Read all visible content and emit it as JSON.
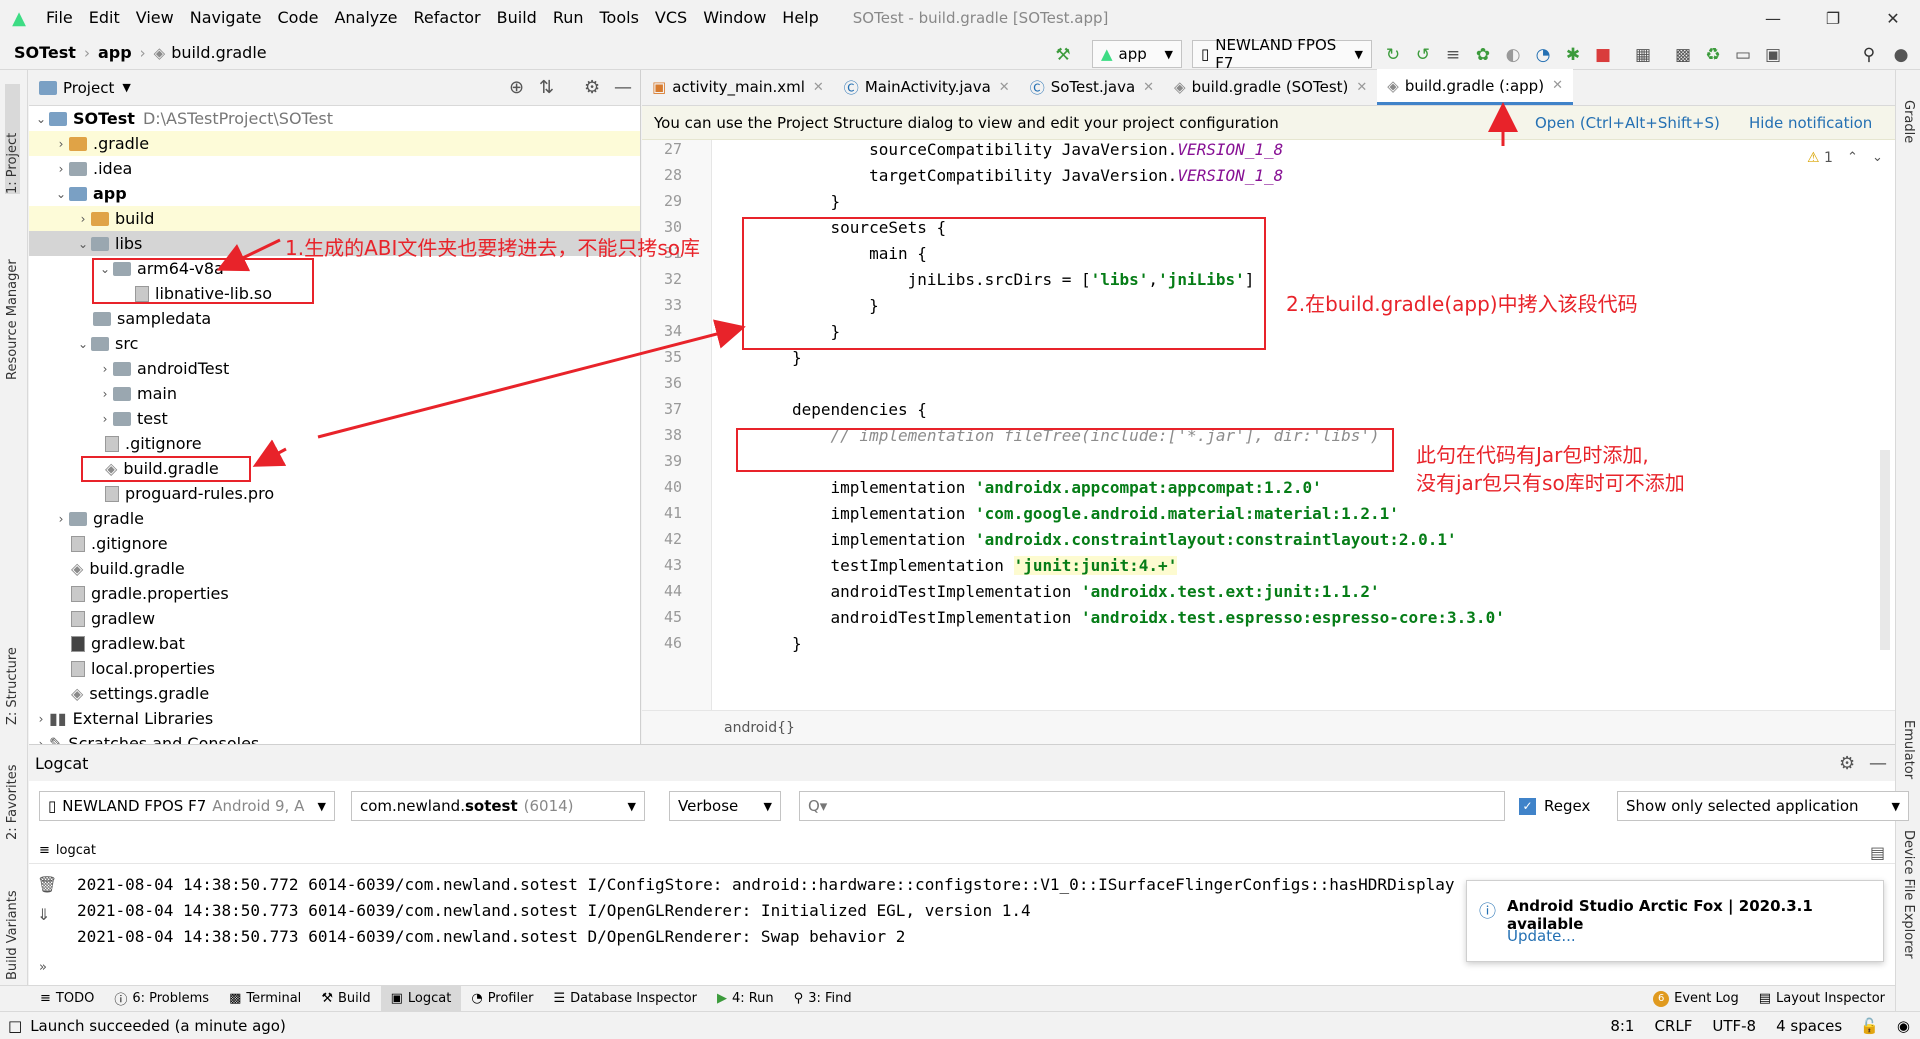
{
  "window": {
    "title": "SOTest - build.gradle [SOTest.app]"
  },
  "menu": [
    "File",
    "Edit",
    "View",
    "Navigate",
    "Code",
    "Analyze",
    "Refactor",
    "Build",
    "Run",
    "Tools",
    "VCS",
    "Window",
    "Help"
  ],
  "breadcrumb": {
    "project": "SOTest",
    "module": "app",
    "file": "build.gradle"
  },
  "toolbar": {
    "run_config": "app",
    "device": "NEWLAND FPOS F7"
  },
  "left_tabs": {
    "project": "1: Project",
    "resource_manager": "Resource Manager",
    "structure": "Z: Structure",
    "favorites": "2: Favorites",
    "build_variants": "Build Variants"
  },
  "right_tabs": {
    "gradle": "Gradle",
    "emulator": "Emulator",
    "device_explorer": "Device File Explorer"
  },
  "project_panel": {
    "title": "Project",
    "tree": [
      {
        "label": "SOTest",
        "extra": "D:\\ASTestProject\\SOTest",
        "bold": true
      },
      {
        "label": ".gradle"
      },
      {
        "label": ".idea"
      },
      {
        "label": "app",
        "bold": true
      },
      {
        "label": "build"
      },
      {
        "label": "libs"
      },
      {
        "label": "arm64-v8a"
      },
      {
        "label": "libnative-lib.so"
      },
      {
        "label": "sampledata"
      },
      {
        "label": "src"
      },
      {
        "label": "androidTest"
      },
      {
        "label": "main"
      },
      {
        "label": "test"
      },
      {
        "label": ".gitignore"
      },
      {
        "label": "build.gradle"
      },
      {
        "label": "proguard-rules.pro"
      },
      {
        "label": "gradle"
      },
      {
        "label": ".gitignore"
      },
      {
        "label": "build.gradle"
      },
      {
        "label": "gradle.properties"
      },
      {
        "label": "gradlew"
      },
      {
        "label": "gradlew.bat"
      },
      {
        "label": "local.properties"
      },
      {
        "label": "settings.gradle"
      },
      {
        "label": "External Libraries"
      },
      {
        "label": "Scratches and Consoles"
      }
    ]
  },
  "editor": {
    "tabs": [
      {
        "label": "activity_main.xml"
      },
      {
        "label": "MainActivity.java"
      },
      {
        "label": "SoTest.java"
      },
      {
        "label": "build.gradle (SOTest)"
      },
      {
        "label": "build.gradle (:app)"
      }
    ],
    "notice": {
      "text": "You can use the Project Structure dialog to view and edit your project configuration",
      "open_link": "Open (Ctrl+Alt+Shift+S)",
      "hide_link": "Hide notification"
    },
    "warning_count": "1",
    "line_numbers": [
      "27",
      "28",
      "29",
      "30",
      "31",
      "32",
      "33",
      "34",
      "35",
      "36",
      "37",
      "38",
      "39",
      "40",
      "41",
      "42",
      "43",
      "44",
      "45",
      "46"
    ],
    "code": {
      "l27_a": "        sourceCompatibility JavaVersion.",
      "l27_b": "VERSION_1_8",
      "l28_a": "        targetCompatibility JavaVersion.",
      "l28_b": "VERSION_1_8",
      "l29": "    }",
      "l30": "    sourceSets {",
      "l31": "        main {",
      "l32_a": "            jniLibs.srcDirs = [",
      "l32_b": "'libs'",
      "l32_c": ",",
      "l32_d": "'jniLibs'",
      "l32_e": "]",
      "l33": "        }",
      "l34": "    }",
      "l35": "}",
      "l37": "dependencies {",
      "l38": "    // implementation fileTree(include:['*.jar'], dir:'libs')",
      "l40_a": "    implementation ",
      "l40_b": "'androidx.appcompat:appcompat:1.2.0'",
      "l41_a": "    implementation ",
      "l41_b": "'com.google.android.material:material:1.2.1'",
      "l42_a": "    implementation ",
      "l42_b": "'androidx.constraintlayout:constraintlayout:2.0.1'",
      "l43_a": "    testImplementation ",
      "l43_b": "'junit:junit:4.+'",
      "l44_a": "    androidTestImplementation ",
      "l44_b": "'androidx.test.ext:junit:1.1.2'",
      "l45_a": "    androidTestImplementation ",
      "l45_b": "'androidx.test.espresso:espresso-core:3.3.0'",
      "l46": "}"
    },
    "footer_breadcrumb": "android{}"
  },
  "annotations": {
    "note1": "1.生成的ABI文件夹也要拷进去，不能只拷so库",
    "note2": "2.在build.gradle(app)中拷入该段代码",
    "note3_line1": "此句在代码有Jar包时添加,",
    "note3_line2": "没有jar包只有so库时可不添加"
  },
  "logcat": {
    "title": "Logcat",
    "device_name": "NEWLAND FPOS F7",
    "device_detail": "Android 9, A",
    "process_name": "com.newland.",
    "process_bold": "sotest",
    "process_pid": "(6014)",
    "level": "Verbose",
    "search_placeholder": "Q▾",
    "regex_label": "Regex",
    "filter": "Show only selected application",
    "sub_label": "logcat",
    "lines": [
      "2021-08-04 14:38:50.772 6014-6039/com.newland.sotest I/ConfigStore: android::hardware::configstore::V1_0::ISurfaceFlingerConfigs::hasHDRDisplay retrieved: 0",
      "2021-08-04 14:38:50.773 6014-6039/com.newland.sotest I/OpenGLRenderer: Initialized EGL, version 1.4",
      "2021-08-04 14:38:50.773 6014-6039/com.newland.sotest D/OpenGLRenderer: Swap behavior 2"
    ]
  },
  "notification": {
    "title": "Android Studio Arctic Fox | 2020.3.1 available",
    "link": "Update..."
  },
  "bottom_tabs": {
    "todo": "TODO",
    "problems": "6: Problems",
    "terminal": "Terminal",
    "build": "Build",
    "logcat": "Logcat",
    "profiler": "Profiler",
    "db": "Database Inspector",
    "run": "4: Run",
    "find": "3: Find",
    "event_log": "Event Log",
    "event_count": "6",
    "layout_inspector": "Layout Inspector"
  },
  "status": {
    "message": "Launch succeeded (a minute ago)",
    "position": "8:1",
    "line_sep": "CRLF",
    "encoding": "UTF-8",
    "indent": "4 spaces"
  },
  "colors": {
    "annotation": "#e8232a",
    "active_tab": "#4083c9",
    "string": "#067d17"
  }
}
